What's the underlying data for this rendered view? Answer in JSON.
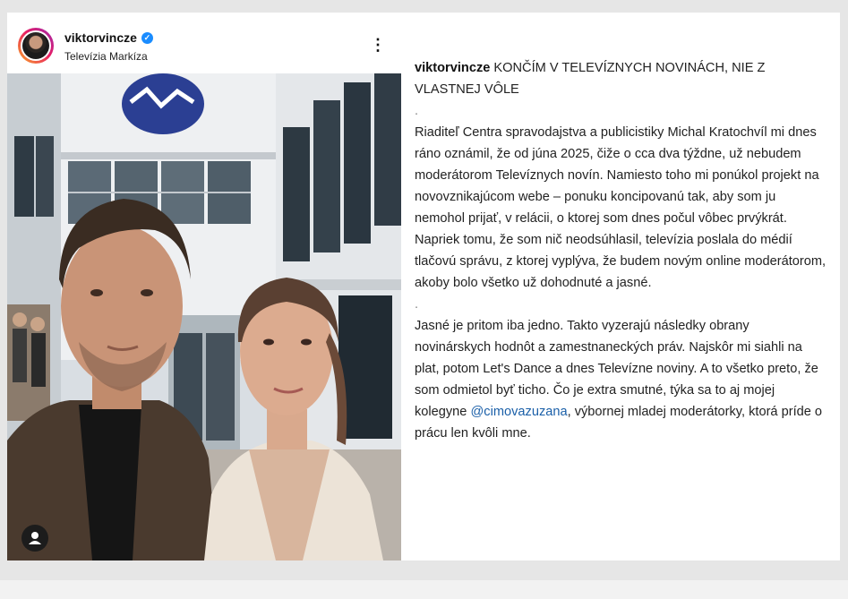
{
  "post": {
    "username": "viktorvincze",
    "location": "Televízia Markíza",
    "more_icon": "more-vertical-icon",
    "verified_icon": "verified-badge-icon",
    "tag_icon": "user-tag-icon"
  },
  "caption": {
    "username": "viktorvincze",
    "title": "KONČÍM V TELEVÍZNYCH NOVINÁCH, NIE Z VLASTNEJ VÔLE",
    "separator1": ".",
    "paragraph1": "Riaditeľ Centra spravodajstva a publicistiky Michal Kratochvíl mi dnes ráno oznámil, že od júna 2025, čiže o cca dva týždne, už nebudem moderátorom Televíznych novín. Namiesto toho mi ponúkol projekt na novovznikajúcom webe – ponuku koncipovanú tak, aby som ju nemohol prijať, v relácii, o ktorej som dnes počul vôbec prvýkrát. Napriek tomu, že som nič neodsúhlasil, televízia poslala do médií tlačovú správu, z ktorej vyplýva, že budem novým online moderátorom, akoby bolo všetko už dohodnuté a jasné.",
    "separator2": ".",
    "paragraph2_before": "Jasné je pritom iba jedno. Takto vyzerajú následky obrany novinárskych hodnôt a zamestnaneckých práv. Najskôr mi siahli na plat, potom Let's Dance a dnes Televízne noviny. A to všetko preto, že som odmietol byť ticho. Čo je extra smutné, týka sa to aj mojej kolegyne ",
    "mention": "@cimovazuzana",
    "paragraph2_after": ", výbornej mladej moderátorky, ktorá príde o prácu len kvôli mne."
  },
  "colors": {
    "verified": "#1a8cff",
    "mention": "#1a5fa8",
    "logo_blue": "#2b3f93"
  }
}
